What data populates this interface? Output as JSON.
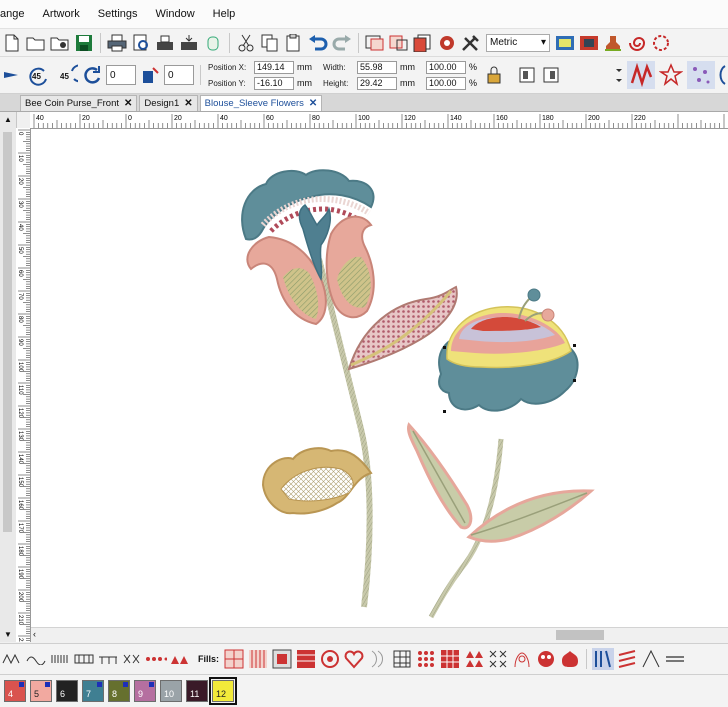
{
  "menubar": {
    "items": [
      "ange",
      "Artwork",
      "Settings",
      "Window",
      "Help"
    ]
  },
  "toolbar": {
    "units_label": "Metric",
    "icons": [
      "new-file-icon",
      "open-folder-icon",
      "open-image-icon",
      "save-icon",
      "print-icon",
      "print-preview-icon",
      "machine-send-icon",
      "machine-receive-icon",
      "usb-icon",
      "cut-icon",
      "copy-icon",
      "paste-icon",
      "undo-icon",
      "redo-icon",
      "group-icon",
      "ungroup-icon",
      "design-properties-icon",
      "settings-gear-icon",
      "tools-icon"
    ],
    "right_icons": [
      "view-toggle-icon",
      "film-icon",
      "stamp-icon",
      "spiral-icon",
      "snowflake-icon"
    ]
  },
  "transform": {
    "rotate_left_label": "45",
    "rotate_right_label": "45",
    "rotate_value": "0",
    "slant_value": "0",
    "position_x_label": "Position X:",
    "position_x_value": "149.14",
    "position_y_label": "Position Y:",
    "position_y_value": "-16.10",
    "width_label": "Width:",
    "width_value": "55.98",
    "height_label": "Height:",
    "height_value": "29.42",
    "unit": "mm",
    "scale_w": "100.00",
    "scale_h": "100.00",
    "percent": "%"
  },
  "tabs": [
    {
      "label": "Bee Coin Purse_Front",
      "close": "✕",
      "active": false
    },
    {
      "label": "Design1",
      "close": "✕",
      "active": false
    },
    {
      "label": "Blouse_Sleeve Flowers",
      "close": "✕",
      "active": true
    }
  ],
  "ruler": {
    "h_labels": [
      "40",
      "20",
      "0",
      "20",
      "40",
      "60",
      "80",
      "100",
      "120",
      "140",
      "160",
      "180",
      "200",
      "220"
    ],
    "v_labels": [
      "0",
      "10",
      "20",
      "30",
      "40",
      "50",
      "60",
      "70",
      "80",
      "90",
      "100",
      "110",
      "120",
      "130",
      "140",
      "150",
      "160",
      "170",
      "180",
      "190",
      "200",
      "210",
      "220"
    ]
  },
  "stitchbar": {
    "fills_label": "Fills:"
  },
  "palette": [
    {
      "num": "4",
      "color": "#d9534f",
      "marked": true
    },
    {
      "num": "5",
      "color": "#f2a9a0",
      "marked": true
    },
    {
      "num": "6",
      "color": "#222222",
      "marked": false
    },
    {
      "num": "7",
      "color": "#3f7f92",
      "marked": true
    },
    {
      "num": "8",
      "color": "#66702e",
      "marked": true
    },
    {
      "num": "9",
      "color": "#b56fa0",
      "marked": true
    },
    {
      "num": "10",
      "color": "#9aa3a8",
      "marked": false
    },
    {
      "num": "11",
      "color": "#3a1a28",
      "marked": false
    },
    {
      "num": "12",
      "color": "#f2ea3a",
      "marked": false,
      "selected": true
    }
  ],
  "colors": {
    "teal": "#5e8f9a",
    "pink": "#e8a098",
    "tan": "#d3b57a",
    "yellow": "#efe27a",
    "sage": "#a8b58a",
    "stem": "#b8bca0"
  }
}
